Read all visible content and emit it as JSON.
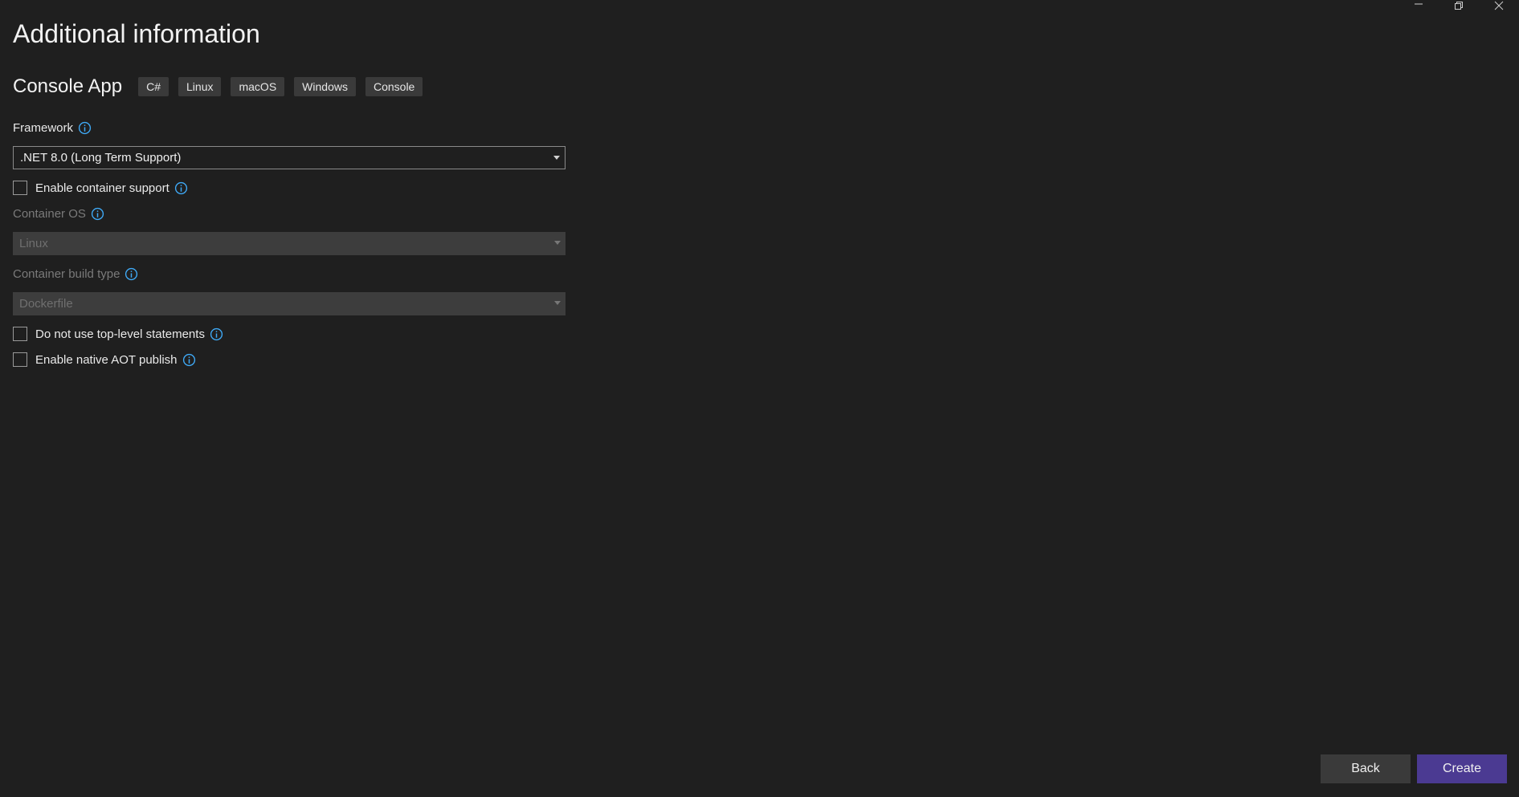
{
  "header": {
    "title": "Additional information"
  },
  "template": {
    "name": "Console App",
    "tags": [
      "C#",
      "Linux",
      "macOS",
      "Windows",
      "Console"
    ]
  },
  "framework": {
    "label": "Framework",
    "value": ".NET 8.0 (Long Term Support)"
  },
  "container_support": {
    "label": "Enable container support",
    "checked": false
  },
  "container_os": {
    "label": "Container OS",
    "value": "Linux",
    "enabled": false
  },
  "container_build_type": {
    "label": "Container build type",
    "value": "Dockerfile",
    "enabled": false
  },
  "top_level_statements": {
    "label": "Do not use top-level statements",
    "checked": false
  },
  "native_aot": {
    "label": "Enable native AOT publish",
    "checked": false
  },
  "footer": {
    "back_label": "Back",
    "create_label": "Create"
  },
  "colors": {
    "accent": "#4b3a92",
    "info_icon": "#3fa9f5",
    "background": "#1f1f1f"
  },
  "icons": {
    "minimize": "minimize-icon",
    "restore": "restore-icon",
    "close": "close-icon",
    "info": "info-icon",
    "dropdown": "chevron-down-icon"
  }
}
